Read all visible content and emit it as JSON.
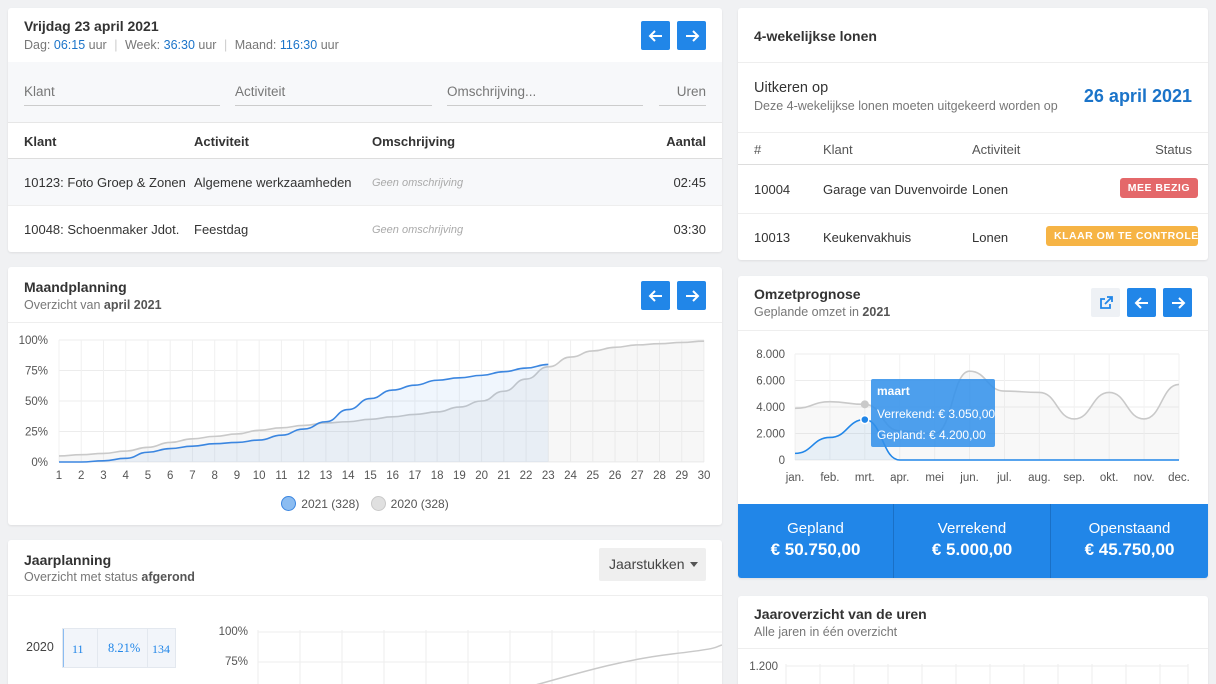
{
  "dag": {
    "title": "Vrijdag 23 april 2021",
    "dag_label": "Dag:",
    "dag_value": "06:15",
    "dag_unit": "uur",
    "week_label": "Week:",
    "week_value": "36:30",
    "week_unit": "uur",
    "maand_label": "Maand:",
    "maand_value": "116:30",
    "maand_unit": "uur",
    "inputs": {
      "klant": "Klant",
      "activiteit": "Activiteit",
      "omschrijving": "Omschrijving...",
      "uren": "Uren"
    },
    "columns": [
      "Klant",
      "Activiteit",
      "Omschrijving",
      "Aantal"
    ],
    "rows": [
      {
        "klant": "10123: Foto Groep & Zonen",
        "activiteit": "Algemene werkzaamheden",
        "omschrijving": "Geen omschrijving",
        "aantal": "02:45"
      },
      {
        "klant": "10048: Schoenmaker Jdot...",
        "activiteit": "Feestdag",
        "omschrijving": "Geen omschrijving",
        "aantal": "03:30"
      }
    ]
  },
  "maand": {
    "title": "Maandplanning",
    "sub_prefix": "Overzicht van",
    "sub_bold": "april 2021",
    "legend": [
      "2021 (328)",
      "2020 (328)"
    ]
  },
  "jaar": {
    "title": "Jaarplanning",
    "sub_prefix": "Overzicht met status",
    "sub_bold": "afgerond",
    "select": "Jaarstukken",
    "row_year": "2020",
    "row_count": "11",
    "row_pct": "8.21%",
    "row_total": "134",
    "y_ticks": [
      "100%",
      "75%"
    ]
  },
  "lonen": {
    "title": "4-wekelijkse lonen",
    "uitkeren_title": "Uitkeren op",
    "uitkeren_sub": "Deze 4-wekelijkse lonen moeten uitgekeerd worden op",
    "date": "26 april 2021",
    "columns": [
      "#",
      "Klant",
      "Activiteit",
      "Status"
    ],
    "rows": [
      {
        "nr": "10004",
        "klant": "Garage van Duvenvoirde",
        "activiteit": "Lonen",
        "status": "MEE BEZIG",
        "status_color": "#e4686a"
      },
      {
        "nr": "10013",
        "klant": "Keukenvakhuis",
        "activiteit": "Lonen",
        "status": "KLAAR OM TE CONTROLE...",
        "status_color": "#f6b445"
      }
    ]
  },
  "omzet": {
    "title": "Omzetprognose",
    "sub_prefix": "Geplande omzet in",
    "sub_bold": "2021",
    "tooltip": {
      "title": "maart",
      "line1": "Verrekend: € 3.050,00",
      "line2": "Gepland: € 4.200,00"
    },
    "stats": [
      {
        "label": "Gepland",
        "value": "€ 50.750,00"
      },
      {
        "label": "Verrekend",
        "value": "€ 5.000,00"
      },
      {
        "label": "Openstaand",
        "value": "€ 45.750,00"
      }
    ]
  },
  "uren": {
    "title": "Jaaroverzicht van de uren",
    "sub": "Alle jaren in één overzicht",
    "y_ticks": [
      "1.200"
    ]
  },
  "colors": {
    "accent": "#2186e8",
    "series_2021": "#3b86e0",
    "series_2020": "#c9c9c9",
    "danger": "#e4686a",
    "warning": "#f6b445"
  },
  "chart_data": [
    {
      "type": "area",
      "title": "",
      "x": [
        1,
        2,
        3,
        4,
        5,
        6,
        7,
        8,
        9,
        10,
        11,
        12,
        13,
        14,
        15,
        16,
        17,
        18,
        19,
        20,
        21,
        22,
        23,
        24,
        25,
        26,
        27,
        28,
        29,
        30
      ],
      "ylim": [
        0,
        100
      ],
      "y_ticks": [
        "100%",
        "75%",
        "50%",
        "25%",
        "0%"
      ],
      "series": [
        {
          "name": "2021 (328)",
          "values": [
            0,
            0,
            1,
            3,
            8,
            11,
            13,
            15,
            16,
            18,
            22,
            27,
            33,
            43,
            52,
            59,
            63,
            67,
            69,
            71,
            74,
            77,
            80,
            null,
            null,
            null,
            null,
            null,
            null,
            null
          ]
        },
        {
          "name": "2020 (328)",
          "values": [
            5,
            6,
            7,
            9,
            12,
            16,
            19,
            21,
            23,
            26,
            28,
            30,
            32,
            33,
            35,
            37,
            39,
            41,
            45,
            50,
            58,
            68,
            78,
            86,
            91,
            94,
            96,
            97,
            98,
            99
          ]
        }
      ]
    },
    {
      "type": "line",
      "title": "",
      "categories": [
        "jan.",
        "feb.",
        "mrt.",
        "apr.",
        "mei",
        "jun.",
        "jul.",
        "aug.",
        "sep.",
        "okt.",
        "nov.",
        "dec."
      ],
      "ylim": [
        0,
        8000
      ],
      "y_ticks": [
        "8.000",
        "6.000",
        "4.000",
        "2.000",
        "0"
      ],
      "series": [
        {
          "name": "Verrekend",
          "values": [
            500,
            1700,
            3050,
            0,
            0,
            0,
            0,
            0,
            0,
            0,
            0,
            0
          ]
        },
        {
          "name": "Gepland",
          "values": [
            3900,
            4400,
            4200,
            2200,
            2000,
            6700,
            5200,
            5100,
            3100,
            5100,
            3100,
            5700
          ]
        }
      ]
    }
  ]
}
